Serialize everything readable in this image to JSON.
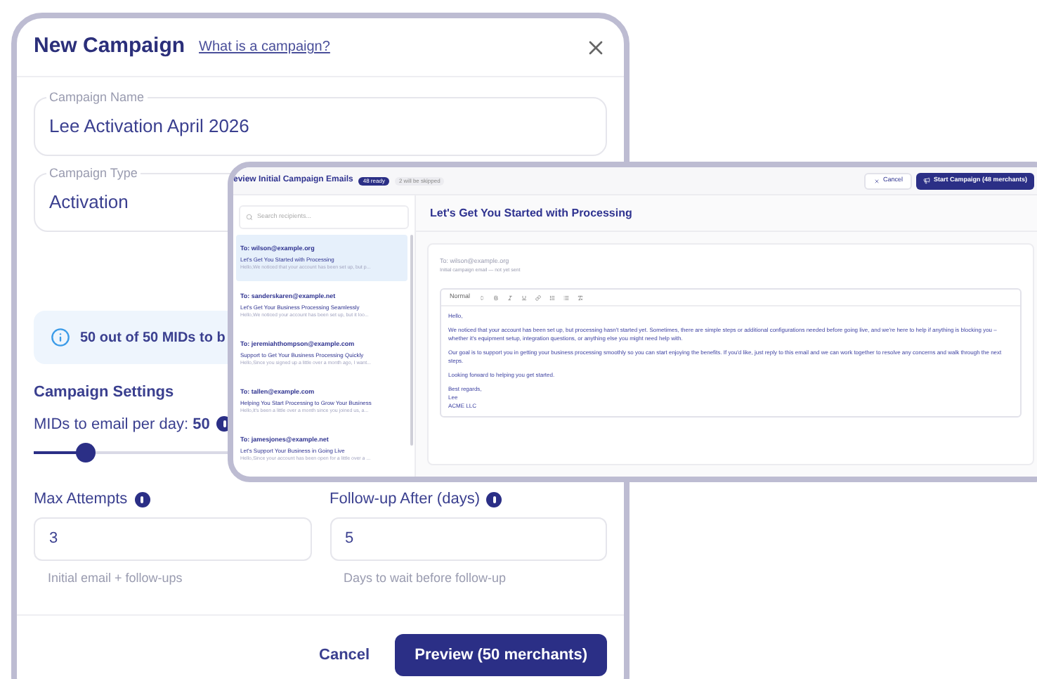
{
  "new_campaign_dialog": {
    "title": "New Campaign",
    "help_link": "What is a campaign?",
    "fields": [
      {
        "label": "Campaign Name",
        "value": "Lee Activation April 2026"
      },
      {
        "label": "Campaign Type",
        "value": "Activation"
      }
    ],
    "info_banner": "50 out of 50 MIDs to b",
    "settings_heading": "Campaign Settings",
    "per_day": {
      "label": "MIDs to email per day:",
      "value": "50",
      "level": 0.09
    },
    "number_fields": [
      {
        "label": "Max Attempts",
        "value": "3",
        "helper": "Initial email + follow-ups"
      },
      {
        "label": "Follow-up After (days)",
        "value": "5",
        "helper": "Days to wait before follow-up"
      }
    ],
    "buttons": [
      {
        "label": "Cancel",
        "kind": "text"
      },
      {
        "label": "Preview (50 merchants)",
        "kind": "primary"
      }
    ]
  },
  "review_panel": {
    "title": "eview Initial Campaign Emails",
    "badges": [
      {
        "label": "48 ready",
        "kind": "primary"
      },
      {
        "label": "2 will be skipped",
        "kind": "muted"
      }
    ],
    "actions": [
      {
        "label": "Cancel",
        "kind": "secondary"
      },
      {
        "label": "Start Campaign (48 merchants)",
        "kind": "primary"
      }
    ],
    "search": {
      "placeholder": "Search recipients..."
    },
    "recipients": [
      {
        "to": "To: wilson@example.org",
        "subject": "Let's Get You Started with Processing",
        "preview": "Hello,We noticed that your account has been set up, but p...",
        "selected": true
      },
      {
        "to": "To: sanderskaren@example.net",
        "subject": "Let's Get Your Business Processing Seamlessly",
        "preview": "Hello,We noticed your account has been set up, but it loo...",
        "selected": false
      },
      {
        "to": "To: jeremiahthompson@example.com",
        "subject": "Support to Get Your Business Processing Quickly",
        "preview": "Hello,Since you signed up a little over a month ago, I want...",
        "selected": false
      },
      {
        "to": "To: tallen@example.com",
        "subject": "Helping You Start Processing to Grow Your Business",
        "preview": "Hello,It's been a little over a month since you joined us, a...",
        "selected": false
      },
      {
        "to": "To: jamesjones@example.net",
        "subject": "Let's Support Your Business in Going Live",
        "preview": "Hello,Since your account has been open for a little over a ...",
        "selected": false
      }
    ],
    "preview": {
      "subject": "Let's Get You Started with Processing",
      "to": "To: wilson@example.org",
      "status": "Initial campaign email — not yet sent",
      "toolbar": {
        "style": "Normal"
      },
      "body": [
        "Hello,",
        "We noticed that your account has been set up, but processing hasn't started yet. Sometimes, there are simple steps or additional configurations needed before going live, and we're here to help if anything is blocking you – whether it's equipment setup, integration questions, or anything else you might need help with.",
        "Our goal is to support you in getting your business processing smoothly so you can start enjoying the benefits. If you'd like, just reply to this email and we can work together to resolve any concerns and walk through the next steps.",
        "Looking forward to helping you get started."
      ],
      "signature": [
        "Best regards,",
        "Lee",
        "ACME LLC"
      ]
    }
  }
}
